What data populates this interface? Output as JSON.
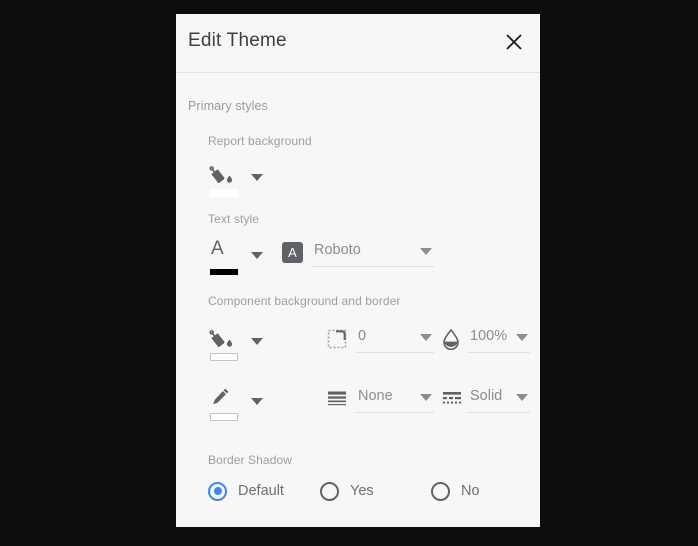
{
  "dialog": {
    "title": "Edit Theme",
    "close_icon": "close-icon"
  },
  "sections": [
    {
      "title": "Primary styles"
    }
  ],
  "fields": {
    "report_background": {
      "label": "Report background",
      "color_icon": "paint-bucket-icon",
      "color_value": "#ffffff",
      "dropdown_icon": "chevron-down-icon"
    },
    "text_style": {
      "label": "Text style",
      "text_color_icon": "text-color-icon",
      "text_color_value": "#000000",
      "text_background_icon": "text-background-icon",
      "text_background_glyph": "A",
      "font_family": "Roboto"
    },
    "component_background_and_border": {
      "label": "Component background and border",
      "fill_icon": "paint-bucket-icon",
      "fill_value": "#ffffff",
      "border_radius_icon": "border-radius-icon",
      "border_radius": "0",
      "opacity_icon": "opacity-droplet-icon",
      "opacity": "100%",
      "border_color_icon": "pencil-icon",
      "border_color_value": "#ffffff",
      "border_weight_icon": "border-weight-icon",
      "border_weight": "None",
      "border_style_icon": "border-style-icon",
      "border_style": "Solid"
    },
    "border_shadow": {
      "label": "Border Shadow",
      "options": [
        {
          "label": "Default",
          "selected": true
        },
        {
          "label": "Yes",
          "selected": false
        },
        {
          "label": "No",
          "selected": false
        }
      ]
    }
  },
  "colors": {
    "accent": "#4285f4",
    "dialog_background": "#f7f7f7",
    "page_background": "#0d0d0d",
    "icon_gray": "#5f6368",
    "label_gray": "#9e9e9e",
    "value_gray": "#8a8d91"
  }
}
